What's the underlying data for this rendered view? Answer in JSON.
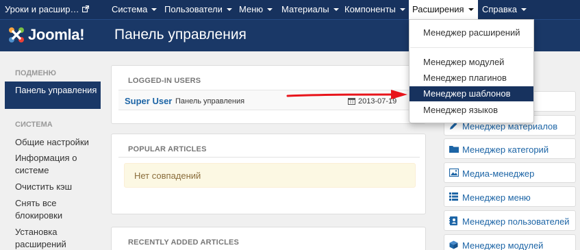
{
  "navbar": {
    "site_link": "Уроки и расшир…",
    "items": [
      "Система",
      "Пользователи",
      "Меню",
      "Материалы",
      "Компоненты",
      "Расширения",
      "Справка"
    ]
  },
  "header": {
    "logo_text": "Joomla!",
    "title": "Панель управления"
  },
  "sidebar": {
    "submenu_heading": "ПОДМЕНЮ",
    "active_item": "Панель управления",
    "system_heading": "СИСТЕМА",
    "items": [
      "Общие настройки",
      "Информация о системе",
      "Очистить кэш",
      "Снять все блокировки",
      "Установка расширений"
    ]
  },
  "panels": {
    "logged_in": {
      "heading": "LOGGED-IN USERS",
      "user": "Super User",
      "location": "Панель управления",
      "date": "2013-07-19"
    },
    "popular": {
      "heading": "POPULAR ARTICLES",
      "empty_message": "Нет совпадений"
    },
    "recent": {
      "heading": "RECENTLY ADDED ARTICLES"
    }
  },
  "quick_icons": [
    {
      "label": "Менеджер материалов",
      "icon": "pencil-icon"
    },
    {
      "label": "Менеджер категорий",
      "icon": "folder-icon"
    },
    {
      "label": "Медиа-менеджер",
      "icon": "image-icon"
    },
    {
      "label": "Менеджер меню",
      "icon": "list-icon"
    },
    {
      "label": "Менеджер пользователей",
      "icon": "address-book-icon"
    },
    {
      "label": "Менеджер модулей",
      "icon": "cube-icon"
    }
  ],
  "dropdown": {
    "items": [
      "Менеджер расширений",
      "Менеджер модулей",
      "Менеджер плагинов",
      "Менеджер шаблонов",
      "Менеджер языков"
    ],
    "highlighted": "Менеджер шаблонов"
  },
  "colors": {
    "navbar": "#17325e",
    "header": "#1a3867",
    "link": "#1d65a6",
    "arrow": "#e8141b",
    "alert_bg": "#fcf8e3"
  }
}
